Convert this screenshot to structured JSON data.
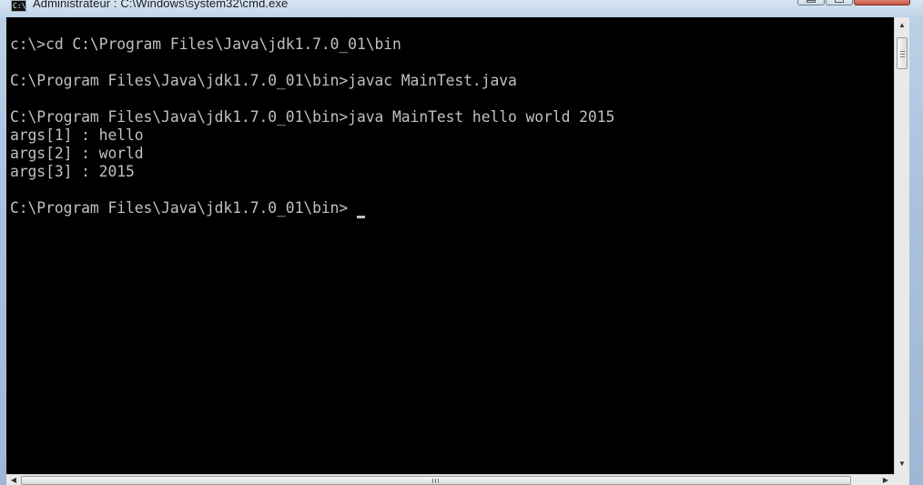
{
  "window": {
    "title": "Administrateur : C:\\Windows\\system32\\cmd.exe",
    "icon": "command-prompt-icon"
  },
  "console": {
    "lines": [
      "c:\\>cd C:\\Program Files\\Java\\jdk1.7.0_01\\bin",
      "",
      "C:\\Program Files\\Java\\jdk1.7.0_01\\bin>javac MainTest.java",
      "",
      "C:\\Program Files\\Java\\jdk1.7.0_01\\bin>java MainTest hello world 2015",
      "args[1] : hello",
      "args[2] : world",
      "args[3] : 2015",
      "",
      "C:\\Program Files\\Java\\jdk1.7.0_01\\bin>"
    ]
  },
  "colors": {
    "console_background": "#000000",
    "console_text": "#c0c0c0"
  }
}
